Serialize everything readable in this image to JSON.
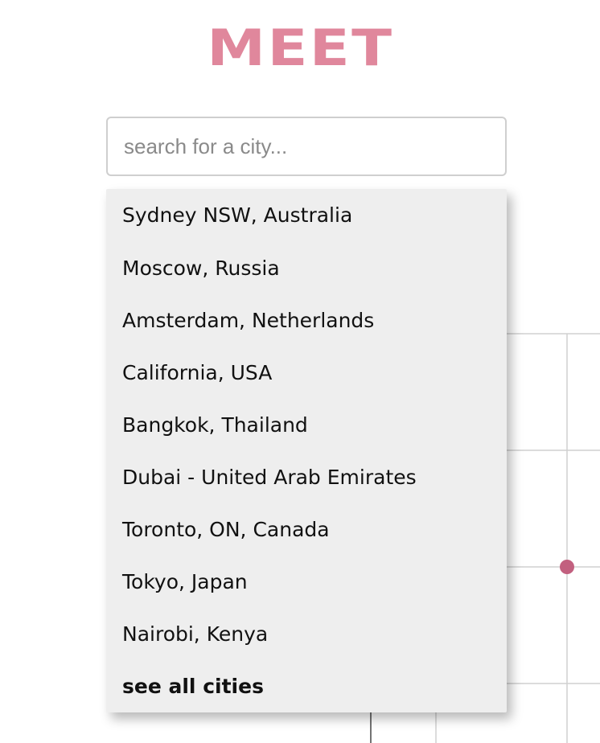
{
  "app": {
    "logo_text": "MEET",
    "brand_color": "#e0879c"
  },
  "search": {
    "placeholder": "search for a city...",
    "value": ""
  },
  "suggestions": {
    "items": [
      "Sydney NSW, Australia",
      "Moscow, Russia",
      "Amsterdam, Netherlands",
      "California, USA",
      "Bangkok, Thailand",
      "Dubai - United Arab Emirates",
      "Toronto, ON, Canada",
      "Tokyo, Japan",
      "Nairobi, Kenya"
    ],
    "see_all_label": "see all cities"
  },
  "colors": {
    "grid_line": "#cfcfcf",
    "axis_line": "#444444",
    "data_point": "#c2607f",
    "dropdown_bg": "#eeeeee"
  }
}
